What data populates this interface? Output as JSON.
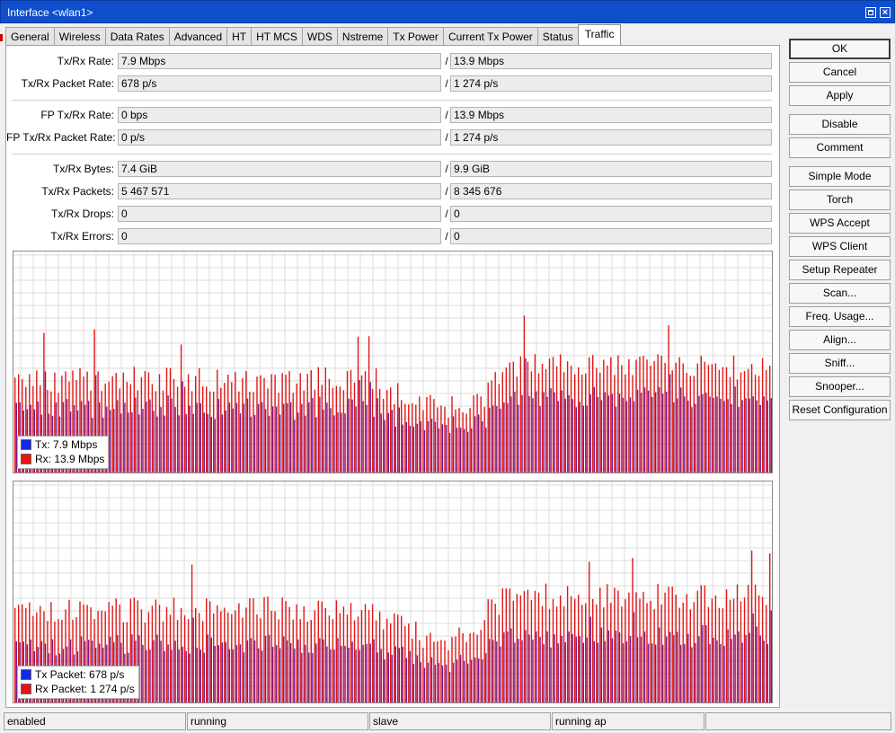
{
  "window": {
    "title": "Interface <wlan1>"
  },
  "tabs": [
    "General",
    "Wireless",
    "Data Rates",
    "Advanced",
    "HT",
    "HT MCS",
    "WDS",
    "Nstreme",
    "Tx Power",
    "Current Tx Power",
    "Status",
    "Traffic"
  ],
  "active_tab": "Traffic",
  "fields": [
    {
      "label": "Tx/Rx Rate:",
      "tx": "7.9 Mbps",
      "rx": "13.9 Mbps"
    },
    {
      "label": "Tx/Rx Packet Rate:",
      "tx": "678 p/s",
      "rx": "1 274 p/s"
    },
    {
      "label": "FP Tx/Rx Rate:",
      "tx": "0 bps",
      "rx": "13.9 Mbps"
    },
    {
      "label": "FP Tx/Rx Packet Rate:",
      "tx": "0 p/s",
      "rx": "1 274 p/s"
    },
    {
      "label": "Tx/Rx Bytes:",
      "tx": "7.4 GiB",
      "rx": "9.9 GiB"
    },
    {
      "label": "Tx/Rx Packets:",
      "tx": "5 467 571",
      "rx": "8 345 676"
    },
    {
      "label": "Tx/Rx Drops:",
      "tx": "0",
      "rx": "0"
    },
    {
      "label": "Tx/Rx Errors:",
      "tx": "0",
      "rx": "0"
    }
  ],
  "separator": "/",
  "graphs": [
    {
      "legend": [
        {
          "label": "Tx:",
          "value": "7.9 Mbps",
          "color": "#1428e8"
        },
        {
          "label": "Rx:",
          "value": "13.9 Mbps",
          "color": "#e81414"
        }
      ]
    },
    {
      "legend": [
        {
          "label": "Tx Packet:",
          "value": "678 p/s",
          "color": "#1428e8"
        },
        {
          "label": "Rx Packet:",
          "value": "1 274 p/s",
          "color": "#e81414"
        }
      ]
    }
  ],
  "buttons": [
    "OK",
    "Cancel",
    "Apply",
    "Disable",
    "Comment",
    "Simple Mode",
    "Torch",
    "WPS Accept",
    "WPS Client",
    "Setup Repeater",
    "Scan...",
    "Freq. Usage...",
    "Align...",
    "Sniff...",
    "Snooper...",
    "Reset Configuration"
  ],
  "status": [
    "enabled",
    "running",
    "slave",
    "running ap",
    ""
  ]
}
